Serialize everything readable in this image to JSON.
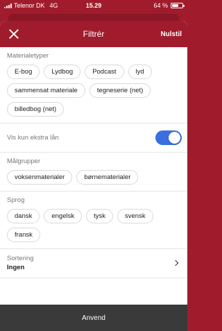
{
  "status_bar": {
    "carrier": "Telenor DK",
    "network": "4G",
    "time": "15.29",
    "battery_text": "64 %",
    "battery_level": 0.64
  },
  "header": {
    "close_icon": "close-icon",
    "title": "Filtrér",
    "reset_label": "Nulstil"
  },
  "material_types": {
    "label": "Materialetyper",
    "items": [
      "E-bog",
      "Lydbog",
      "Podcast",
      "lyd",
      "sammensat materiale",
      "tegneserie (net)",
      "billedbog (net)"
    ]
  },
  "extra_loans": {
    "label": "Vis kun ekstra lån",
    "enabled": true,
    "accent": "#3b6fe0"
  },
  "audiences": {
    "label": "Målgrupper",
    "items": [
      "voksenmaterialer",
      "børnematerialer"
    ]
  },
  "languages": {
    "label": "Sprog",
    "items": [
      "dansk",
      "engelsk",
      "tysk",
      "svensk",
      "fransk"
    ]
  },
  "sorting": {
    "label": "Sortering",
    "value": "Ingen",
    "icon": "chevron-right-icon"
  },
  "apply_label": "Anvend",
  "colors": {
    "brand": "#a01c2c",
    "apply_bar": "#3a3a3a"
  }
}
